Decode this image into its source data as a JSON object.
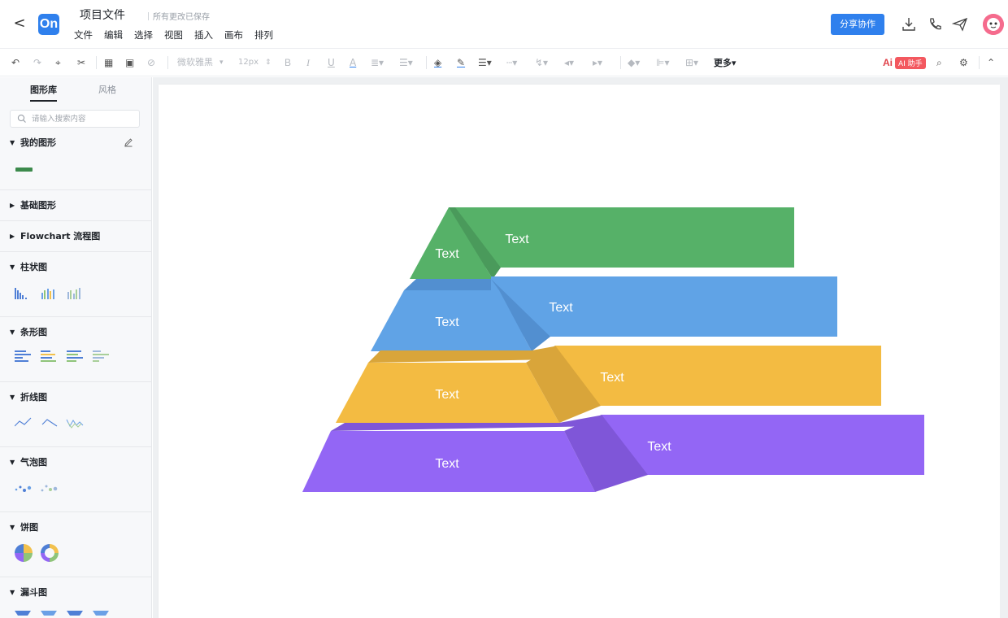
{
  "header": {
    "back_label": "<",
    "logo_text": "On",
    "doc_title": "项目文件",
    "saved_status": "所有更改已保存",
    "menu": [
      "文件",
      "编辑",
      "选择",
      "视图",
      "插入",
      "画布",
      "排列"
    ],
    "share_label": "分享协作",
    "icons": [
      "download-icon",
      "phone-icon",
      "send-icon",
      "avatar"
    ]
  },
  "toolbar": {
    "font_name": "微软雅黑",
    "font_size": "12px",
    "more_label": "更多",
    "ai_logo": "Ai",
    "ai_label": "AI 助手"
  },
  "sidebar": {
    "tabs": [
      "图形库",
      "风格"
    ],
    "search_placeholder": "请输入搜索内容",
    "sections": [
      {
        "title": "我的图形",
        "expanded": true
      },
      {
        "title": "基础图形",
        "expanded": false
      },
      {
        "title": "Flowchart 流程图",
        "expanded": false
      },
      {
        "title": "柱状图",
        "expanded": true
      },
      {
        "title": "条形图",
        "expanded": true
      },
      {
        "title": "折线图",
        "expanded": true
      },
      {
        "title": "气泡图",
        "expanded": true
      },
      {
        "title": "饼图",
        "expanded": true
      },
      {
        "title": "漏斗图",
        "expanded": true
      }
    ]
  },
  "canvas": {
    "levels": [
      {
        "left_text": "Text",
        "right_text": "Text",
        "color": "#56b168",
        "shade": "#4a9a5b"
      },
      {
        "left_text": "Text",
        "right_text": "Text",
        "color": "#60a3e6",
        "shade": "#528fd0"
      },
      {
        "left_text": "Text",
        "right_text": "Text",
        "color": "#f3bb42",
        "shade": "#d9a53a"
      },
      {
        "left_text": "Text",
        "right_text": "Text",
        "color": "#9366f5",
        "shade": "#7f56d8"
      }
    ]
  },
  "colors": {
    "accent": "#2f80ed",
    "ai": "#f3585f"
  }
}
